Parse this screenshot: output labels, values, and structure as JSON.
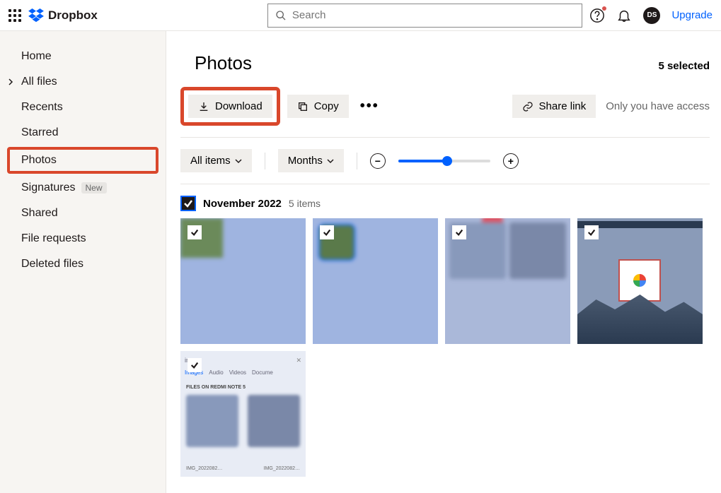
{
  "header": {
    "logo_text": "Dropbox",
    "search_placeholder": "Search",
    "avatar_initials": "DS",
    "upgrade": "Upgrade"
  },
  "sidebar": {
    "items": [
      {
        "label": "Home"
      },
      {
        "label": "All files"
      },
      {
        "label": "Recents"
      },
      {
        "label": "Starred"
      },
      {
        "label": "Photos"
      },
      {
        "label": "Signatures",
        "badge": "New"
      },
      {
        "label": "Shared"
      },
      {
        "label": "File requests"
      },
      {
        "label": "Deleted files"
      }
    ]
  },
  "page": {
    "title": "Photos",
    "selected": "5 selected"
  },
  "toolbar": {
    "download": "Download",
    "copy": "Copy",
    "share": "Share link",
    "access": "Only you have access"
  },
  "filters": {
    "items_label": "All items",
    "group_label": "Months"
  },
  "group": {
    "title": "November 2022",
    "count": "5 items"
  },
  "thumb5": {
    "name": "img",
    "tabs": [
      "Images",
      "Audio",
      "Videos",
      "Docume"
    ],
    "label": "FILES ON REDMI NOTE 5",
    "c1": "IMG_2022082…",
    "c2": "IMG_2022082…"
  }
}
